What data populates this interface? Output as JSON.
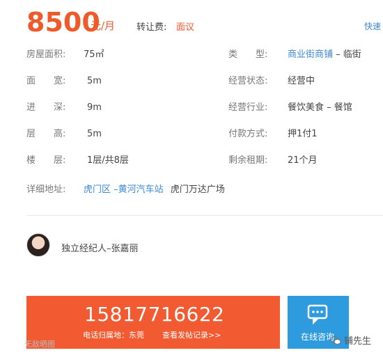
{
  "header": {
    "price": "8500",
    "price_unit": "元/月",
    "transfer_fee_label": "转让费:",
    "transfer_fee_value": "面议",
    "quick_link": "快速"
  },
  "details": {
    "area_label": "房屋面积:",
    "area_value": "75㎡",
    "type_label": "类　　型:",
    "type_value": "商业街商铺",
    "type_suffix": " – 临街",
    "width_label": "面　　宽:",
    "width_value": "5m",
    "status_label": "经营状态:",
    "status_value": "经营中",
    "depth_label": "进　　深:",
    "depth_value": "9m",
    "industry_label": "经营行业:",
    "industry_value": "餐饮美食 – 餐馆",
    "height_label": "层　　高:",
    "height_value": "5m",
    "payment_label": "付款方式:",
    "payment_value": "押1付1",
    "floor_label": "楼　　层:",
    "floor_value": "1层/共8层",
    "lease_label": "剩余租期:",
    "lease_value": "21个月",
    "address_label": "详细地址:",
    "address_district": "虎门区",
    "address_sep": " –",
    "address_area": "黄河汽车站",
    "address_detail": "虎门万达广场"
  },
  "agent": {
    "name": "独立经纪人–张嘉丽"
  },
  "contact": {
    "phone": "15817716622",
    "phone_location": "电话归属地：东莞",
    "post_history": "查看发帖记录>>",
    "consult_label": "在线咨询"
  },
  "watermarks": {
    "left": "无敌晒图",
    "right": "铺先生"
  }
}
